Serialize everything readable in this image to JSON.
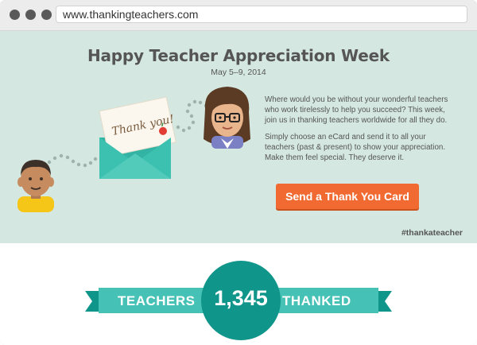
{
  "browser": {
    "url": "www.thankingteachers.com"
  },
  "hero": {
    "title": "Happy Teacher Appreciation Week",
    "date": "May 5–9, 2014",
    "paragraph1": "Where would you be without your wonderful teachers who work tirelessly to help you succeed? This week, join us in thanking teachers worldwide for all they do.",
    "paragraph2": "Simply choose an eCard and send it to all your teachers (past & present) to show your appreciation. Make them feel special. They deserve it.",
    "cta_label": "Send a Thank You Card",
    "card_text": "Thank you!",
    "hashtag": "#thankateacher"
  },
  "counter": {
    "left_label": "TEACHERS",
    "count": "1,345",
    "right_label": "THANKED"
  },
  "colors": {
    "hero_bg": "#d4e7e1",
    "accent_orange": "#f06a31",
    "teal_dark": "#0f958a",
    "teal_light": "#45c1b5",
    "text_gray": "#555555"
  },
  "icons": [
    "window-dot-icon",
    "student-avatar-icon",
    "teacher-avatar-icon",
    "envelope-card-icon",
    "apple-icon"
  ]
}
